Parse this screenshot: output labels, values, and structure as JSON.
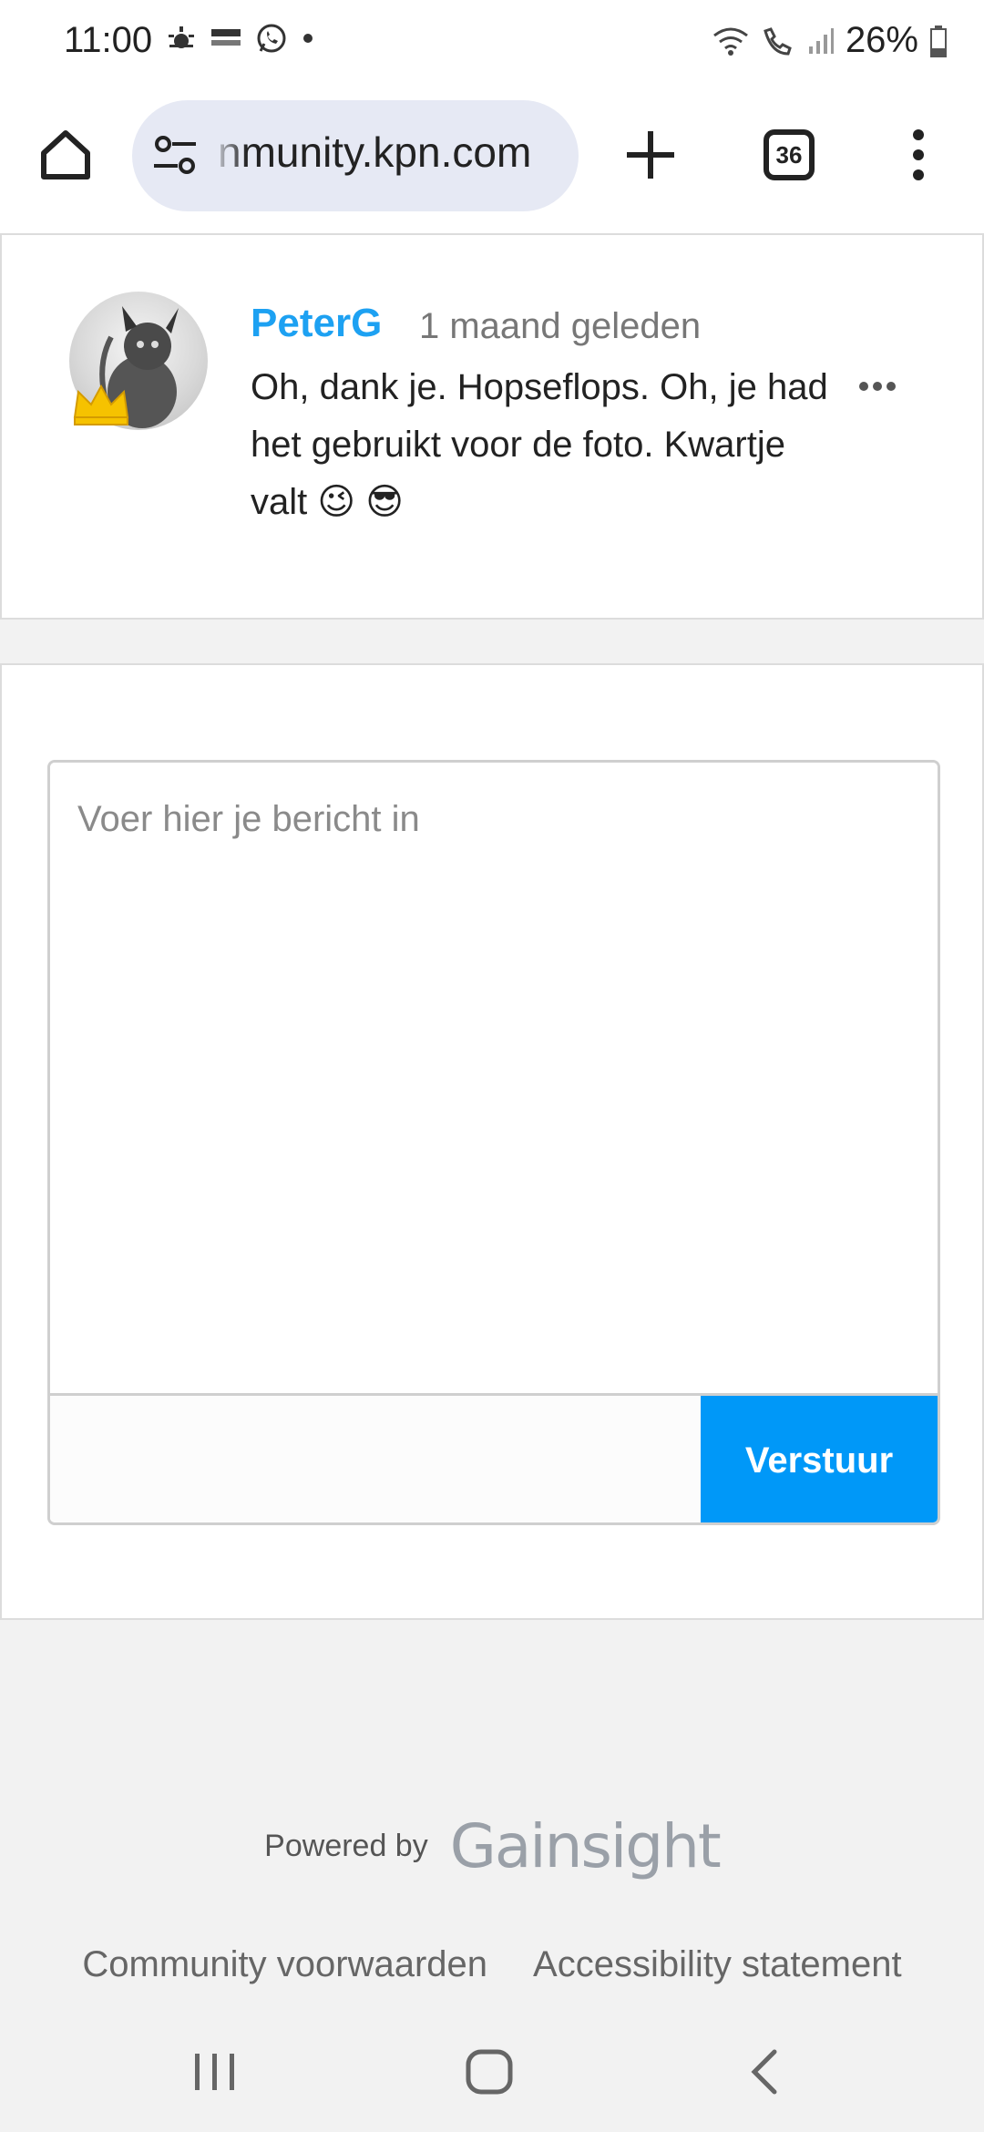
{
  "status_bar": {
    "time": "11:00",
    "battery": "26%",
    "icons": [
      "weather-icon",
      "nos-news-icon",
      "whatsapp-icon",
      "notification-dot-icon",
      "wifi-icon",
      "wifi-call-icon",
      "signal-icon",
      "battery-icon"
    ]
  },
  "browser": {
    "url": "nmunity.kpn.com",
    "tab_count": "36"
  },
  "comment": {
    "author": "PeterG",
    "time": "1 maand geleden",
    "text": "Oh, dank je. Hopseflops. Oh, je had het gebruikt voor de foto. Kwartje valt",
    "emojis": [
      "😉",
      "😎"
    ]
  },
  "reply": {
    "placeholder": "Voer hier je bericht in",
    "send_label": "Verstuur"
  },
  "footer": {
    "powered_by": "Powered by",
    "brand": "Gainsight",
    "links": [
      "Community voorwaarden",
      "Accessibility statement"
    ]
  },
  "colors": {
    "accent": "#1da1f2",
    "button": "#0098f8",
    "background": "#f2f2f2"
  }
}
